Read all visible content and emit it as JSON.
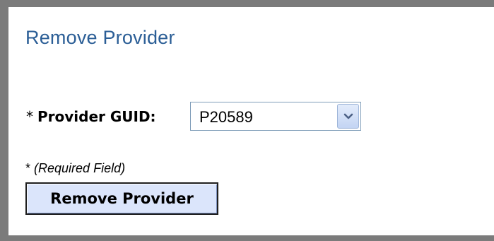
{
  "page": {
    "title": "Remove Provider"
  },
  "form": {
    "required_marker": "*",
    "provider_guid_label": "Provider GUID:",
    "provider_guid_value": "P20589",
    "required_note_marker": "*",
    "required_note_text": "(Required Field)",
    "submit_label": "Remove Provider"
  },
  "icons": {
    "dropdown": "chevron-down-icon"
  },
  "colors": {
    "title": "#2b5e96",
    "frame": "#7b7b7b",
    "button_bg": "#dbe5fb"
  }
}
